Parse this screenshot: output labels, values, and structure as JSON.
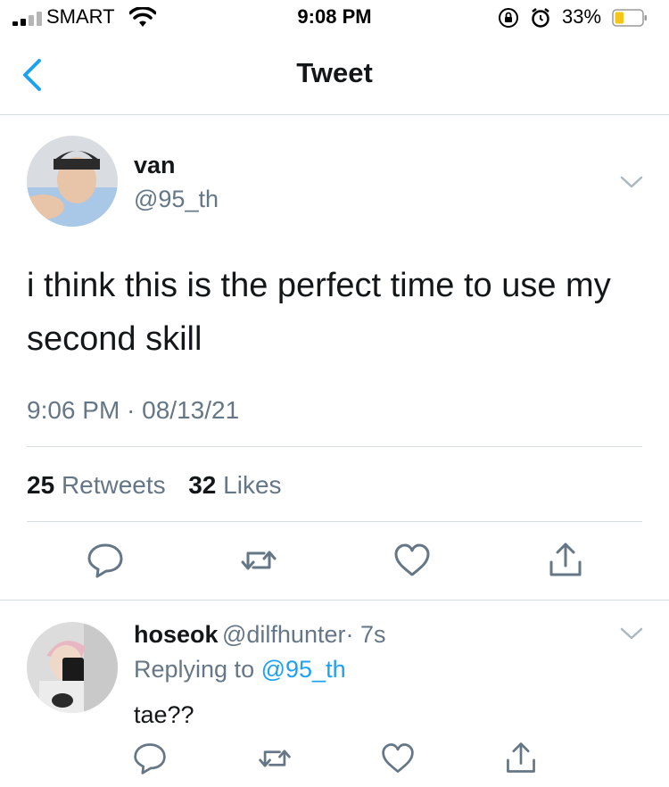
{
  "status_bar": {
    "carrier": "SMART",
    "time": "9:08 PM",
    "battery_percent": "33%",
    "battery_level": 0.33,
    "battery_color": "#f5c518"
  },
  "nav": {
    "back_icon": "chevron-left-icon",
    "title": "Tweet"
  },
  "tweet": {
    "author_name": "van",
    "handle": "@95_th",
    "text": "i think this is the perfect time to use my second skill",
    "timestamp": "9:06 PM · 08/13/21",
    "retweets_count": "25",
    "retweets_label": "Retweets",
    "likes_count": "32",
    "likes_label": "Likes",
    "actions": [
      "reply-icon",
      "retweet-icon",
      "like-icon",
      "share-icon"
    ]
  },
  "reply": {
    "author_name": "hoseok",
    "handle": "@dilfhunter",
    "age": "· 7s",
    "replying_prefix": "Replying to",
    "replying_handle": "@95_th",
    "text": "tae??",
    "actions": [
      "reply-icon",
      "retweet-icon",
      "like-icon",
      "share-icon"
    ]
  },
  "colors": {
    "accent": "#1da1f2",
    "secondary_text": "#657786",
    "primary_text": "#14171a",
    "divider": "#d8dde1"
  }
}
